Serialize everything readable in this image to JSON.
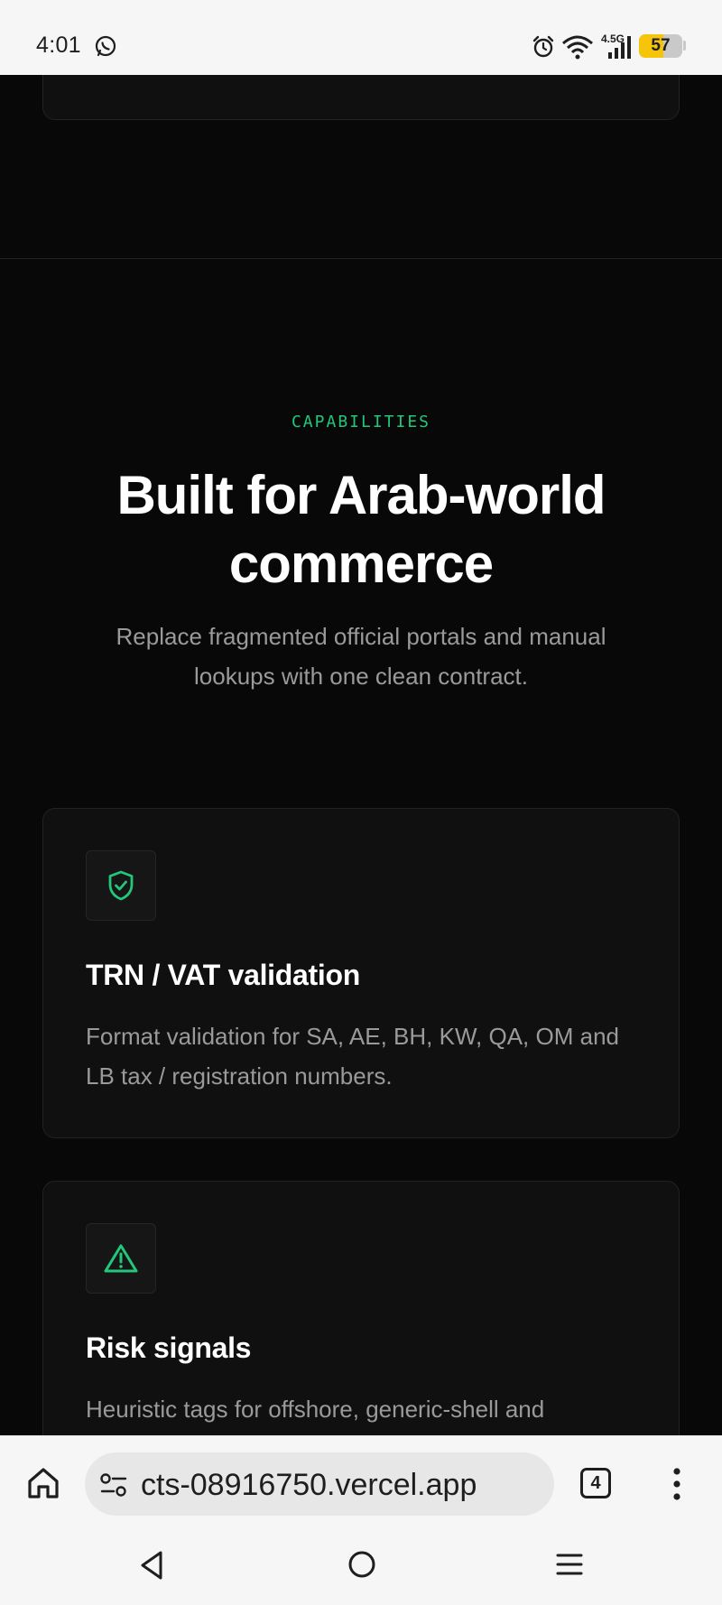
{
  "status_bar": {
    "time": "4:01",
    "network_label": "4.5G",
    "battery_percent": 57
  },
  "section": {
    "eyebrow": "CAPABILITIES",
    "headline": "Built for Arab-world commerce",
    "subtitle": "Replace fragmented official portals and manual lookups with one clean contract."
  },
  "features": [
    {
      "icon": "shield-check-icon",
      "title": "TRN / VAT validation",
      "description": "Format validation for SA, AE, BH, KW, QA, OM and LB tax / registration numbers."
    },
    {
      "icon": "warning-triangle-icon",
      "title": "Risk signals",
      "description": "Heuristic tags for offshore, generic-shell and"
    }
  ],
  "browser": {
    "url": "cts-08916750.vercel.app",
    "tab_count": "4"
  },
  "colors": {
    "accent": "#22c77b",
    "background": "#080808",
    "card": "#101010",
    "battery": "#f6c50a"
  }
}
